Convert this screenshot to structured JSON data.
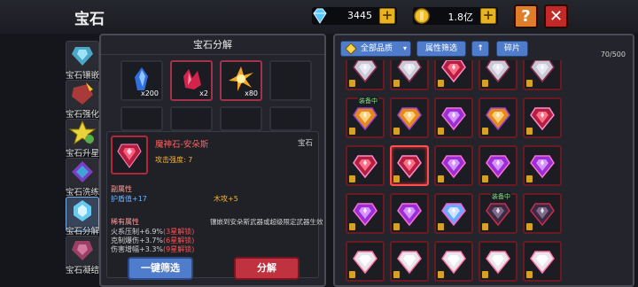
{
  "header": {
    "title": "宝石",
    "diamonds": "3445",
    "gold": "1.8亿",
    "help_label": "?",
    "close_label": "✕"
  },
  "sidebar": {
    "items": [
      {
        "label": "宝石镶嵌",
        "active": false
      },
      {
        "label": "宝石强化",
        "active": false
      },
      {
        "label": "宝石升星",
        "active": false
      },
      {
        "label": "宝石洗练",
        "active": false
      },
      {
        "label": "宝石分解",
        "active": true
      },
      {
        "label": "宝石凝结",
        "active": false
      }
    ]
  },
  "decompose": {
    "title": "宝石分解",
    "materials": [
      {
        "icon": "blue-crystal-icon",
        "count": "x200"
      },
      {
        "icon": "red-crystal-icon",
        "count": "x2"
      },
      {
        "icon": "gold-spark-icon",
        "count": "x80"
      },
      {
        "icon": "",
        "count": ""
      }
    ],
    "detail": {
      "name": "魔神石-安朵斯",
      "type": "宝石",
      "attack": "攻击强度: 7",
      "sub_attr_title": "副属性",
      "sub_attrs": [
        {
          "label": "护盾值+17",
          "value": "木攻+5"
        }
      ],
      "rare_title": "稀有属性",
      "rare_attrs": [
        {
          "text": "火系压制+6.9%",
          "lock": "(3星解锁)"
        },
        {
          "text": "克制爆伤+3.7%",
          "lock": "(6星解锁)"
        },
        {
          "text": "伤害增幅+3.3%",
          "lock": "(9星解锁)"
        }
      ],
      "rare_note": "镶嵌到安朵斯武器或超级限定武器生效"
    },
    "filter_button": "一键筛选",
    "decompose_button": "分解"
  },
  "inventory": {
    "quality_filter": "全部品质",
    "attr_filter": "属性筛选",
    "sort_label": "↑",
    "fragment_label": "碎片",
    "capacity": "70/500",
    "equipped_tag": "装备中",
    "rows": [
      [
        "gem-silver",
        "gem-silver",
        "gem-red",
        "gem-silver",
        "gem-silver"
      ],
      [
        "gem-orange",
        "gem-orange",
        "gem-purple",
        "gem-orange",
        "gem-red"
      ],
      [
        "gem-red",
        "gem-red",
        "gem-purple",
        "gem-purple",
        "gem-purple"
      ],
      [
        "gem-purple",
        "gem-purple",
        "gem-blue",
        "gem-dark",
        "gem-dark"
      ],
      [
        "gem-white",
        "gem-white",
        "gem-white",
        "gem-white",
        "gem-white"
      ]
    ]
  },
  "colors": {
    "accent_red": "#c0323f",
    "accent_blue": "#4f7ccb",
    "gold": "#e8b320"
  }
}
